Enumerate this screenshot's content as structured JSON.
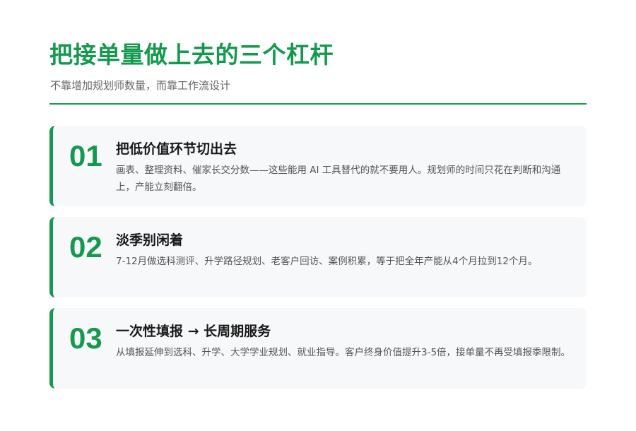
{
  "header": {
    "title": "把接单量做上去的三个杠杆",
    "subtitle": "不靠增加规划师数量，而靠工作流设计"
  },
  "cards": [
    {
      "number": "01",
      "title": "把低价值环节切出去",
      "description": "画表、整理资料、催家长交分数——这些能用 AI 工具替代的就不要用人。规划师的时间只花在判断和沟通上，产能立刻翻倍。"
    },
    {
      "number": "02",
      "title": "淡季别闲着",
      "description": "7-12月做选科测评、升学路径规划、老客户回访、案例积累，等于把全年产能从4个月拉到12个月。"
    },
    {
      "number": "03",
      "title": "一次性填报 → 长周期服务",
      "description": "从填报延伸到选科、升学、大学学业规划、就业指导。客户终身价值提升3-5倍，接单量不再受填报季限制。"
    }
  ],
  "colors": {
    "accent": "#15994f",
    "card_background": "#f7f8fa",
    "title_text": "#1a1a1a",
    "body_text": "#555555"
  }
}
